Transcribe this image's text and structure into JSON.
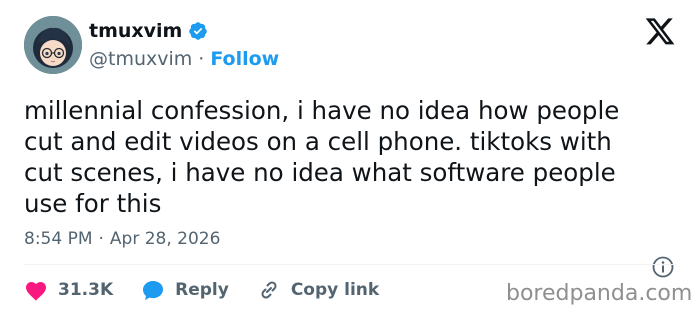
{
  "tweet": {
    "author": {
      "display_name": "tmuxvim",
      "handle": "@tmuxvim",
      "verified": true,
      "avatar_icon": "anime-avatar-icon"
    },
    "separator": "·",
    "follow_label": "Follow",
    "text": "millennial confession, i have no idea how people\ncut and edit videos on a cell phone. tiktoks with\ncut scenes, i have no idea what software people\nuse for this",
    "time": "8:54 PM",
    "date": "Apr 28, 2026",
    "actions": {
      "likes": "31.3K",
      "reply_label": "Reply",
      "copy_label": "Copy link"
    }
  },
  "branding": {
    "platform_icon": "x-logo-icon",
    "watermark": "boredpanda.com"
  },
  "colors": {
    "text": "#0f1419",
    "muted": "#536471",
    "accent": "#1d9bf0",
    "like": "#f91880"
  }
}
